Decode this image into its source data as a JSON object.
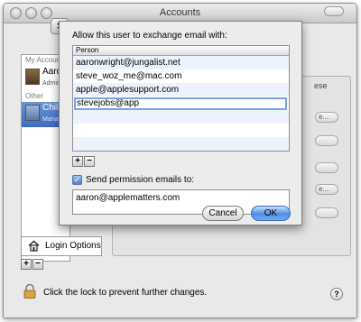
{
  "window": {
    "title": "Accounts",
    "search_partial": "S"
  },
  "sidebar": {
    "my_account_header": "My Account",
    "my_account": {
      "name": "Aaron",
      "role": "Admin"
    },
    "other_accounts_header": "Other Accounts",
    "other_account": {
      "name": "Child",
      "role": "Managed"
    },
    "login_options_label": "Login Options",
    "add_label": "+",
    "remove_label": "−"
  },
  "lock_text": "Click the lock to prevent further changes.",
  "help_label": "?",
  "background": {
    "fragment": "ese",
    "button_fragment": "e..."
  },
  "sheet": {
    "title": "Allow this user to exchange email with:",
    "table_header": "Person",
    "people": [
      "aaronwright@jungalist.net",
      "steve_woz_me@mac.com",
      "apple@applesupport.com"
    ],
    "editing_value": "stevejobs@app",
    "add_label": "+",
    "remove_label": "−",
    "checkbox_label": "Send permission emails to:",
    "checkbox_mark": "✓",
    "permission_email": "aaron@applematters.com",
    "cancel_label": "Cancel",
    "ok_label": "OK"
  }
}
